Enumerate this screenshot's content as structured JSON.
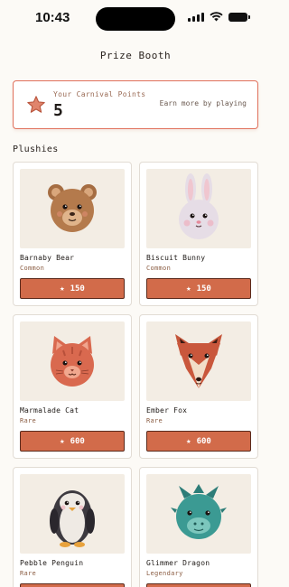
{
  "status_bar": {
    "time": "10:43"
  },
  "nav": {
    "title": "Prize Booth"
  },
  "points": {
    "label": "Your Carnival Points",
    "value": "5",
    "earn_more": "Earn more by playing",
    "icon": "star-icon",
    "icon_color": "#e0715c"
  },
  "section": {
    "title": "Plushies"
  },
  "accent_color": "#d26b4a",
  "plushies": [
    {
      "name": "Barnaby Bear",
      "rarity": "Common",
      "price": "150",
      "icon": "bear-icon"
    },
    {
      "name": "Biscuit Bunny",
      "rarity": "Common",
      "price": "150",
      "icon": "bunny-icon"
    },
    {
      "name": "Marmalade Cat",
      "rarity": "Rare",
      "price": "600",
      "icon": "cat-icon"
    },
    {
      "name": "Ember Fox",
      "rarity": "Rare",
      "price": "600",
      "icon": "fox-icon"
    },
    {
      "name": "Pebble Penguin",
      "rarity": "Rare",
      "price": "",
      "icon": "penguin-icon"
    },
    {
      "name": "Glimmer Dragon",
      "rarity": "Legendary",
      "price": "",
      "icon": "dragon-icon"
    }
  ]
}
